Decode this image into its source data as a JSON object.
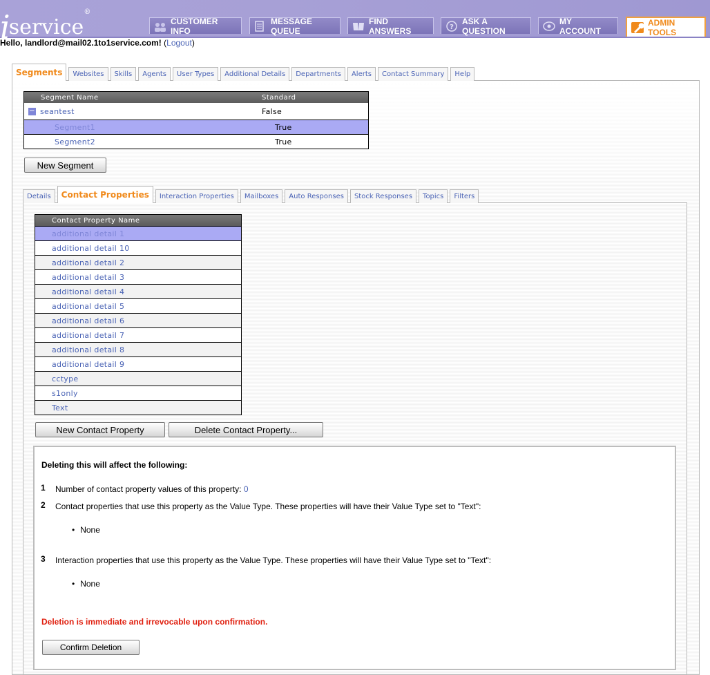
{
  "logo": {
    "i": "i",
    "text": "service",
    "mark": "®"
  },
  "nav": [
    {
      "label": "CUSTOMER INFO",
      "icon": "people-icon"
    },
    {
      "label": "MESSAGE QUEUE",
      "icon": "document-icon"
    },
    {
      "label": "FIND ANSWERS",
      "icon": "book-icon"
    },
    {
      "label": "ASK A QUESTION",
      "icon": "question-icon"
    },
    {
      "label": "MY ACCOUNT",
      "icon": "eye-icon"
    },
    {
      "label": "ADMIN TOOLS",
      "icon": "wrench-icon",
      "active": true
    }
  ],
  "greeting": {
    "hello": "Hello, landlord@mail02.1to1service.com!",
    "open": "(",
    "logout": "Logout",
    "close": ")"
  },
  "top_tabs": [
    "Segments",
    "Websites",
    "Skills",
    "Agents",
    "User Types",
    "Additional Details",
    "Departments",
    "Alerts",
    "Contact Summary",
    "Help"
  ],
  "segment_table": {
    "headers": [
      "Segment Name",
      "Standard"
    ],
    "rows": [
      {
        "name": "seantest",
        "standard": "False",
        "expand": "−"
      },
      {
        "name": "Segment1",
        "standard": "True"
      },
      {
        "name": "Segment2",
        "standard": "True"
      }
    ]
  },
  "new_segment_button": "New Segment",
  "sub_tabs": [
    "Details",
    "Contact Properties",
    "Interaction Properties",
    "Mailboxes",
    "Auto Responses",
    "Stock Responses",
    "Topics",
    "Filters"
  ],
  "contact_properties": {
    "header": "Contact Property Name",
    "items": [
      "additional detail 1",
      "additional detail 10",
      "additional detail 2",
      "additional detail 3",
      "additional detail 4",
      "additional detail 5",
      "additional detail 6",
      "additional detail 7",
      "additional detail 8",
      "additional detail 9",
      "cctype",
      "s1only",
      "Text"
    ]
  },
  "buttons": {
    "new_cp": "New Contact Property",
    "delete_cp": "Delete Contact Property..."
  },
  "delete_info": {
    "title": "Deleting this will affect the following:",
    "item1_num": "1",
    "item1_text": "Number of contact property values of this property:",
    "item1_value": "0",
    "item2_num": "2",
    "item2_text": "Contact properties that use this property as the Value Type. These properties will have their Value Type set to \"Text\":",
    "item2_bullet": "None",
    "item3_num": "3",
    "item3_text": "Interaction properties that use this property as the Value Type. These properties will have their Value Type set to \"Text\":",
    "item3_bullet": "None",
    "warning": "Deletion is immediate and irrevocable upon confirmation.",
    "confirm": "Confirm Deletion"
  }
}
